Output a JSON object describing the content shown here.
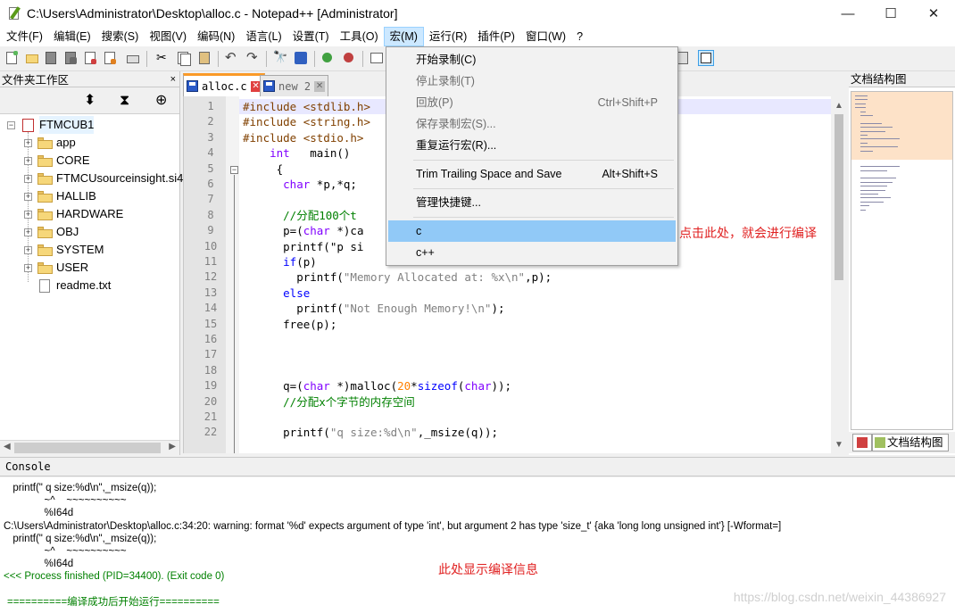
{
  "window": {
    "title": "C:\\Users\\Administrator\\Desktop\\alloc.c - Notepad++ [Administrator]",
    "minimize": "—",
    "maximize": "☐",
    "close": "✕"
  },
  "menubar": {
    "items": [
      "文件(F)",
      "编辑(E)",
      "搜索(S)",
      "视图(V)",
      "编码(N)",
      "语言(L)",
      "设置(T)",
      "工具(O)",
      "宏(M)",
      "运行(R)",
      "插件(P)",
      "窗口(W)",
      "?"
    ]
  },
  "macro_menu": {
    "start_record": "开始录制(C)",
    "stop_record": "停止录制(T)",
    "playback": "回放(P)",
    "playback_shortcut": "Ctrl+Shift+P",
    "save_macro": "保存录制宏(S)...",
    "repeat_run": "重复运行宏(R)...",
    "trim_save": "Trim Trailing Space and Save",
    "trim_save_shortcut": "Alt+Shift+S",
    "manage_shortcuts": "管理快捷键...",
    "macro_c": "c",
    "macro_cpp": "c++"
  },
  "left_panel": {
    "title": "文件夹工作区",
    "close": "×",
    "root": "FTMCUB1",
    "children": [
      "app",
      "CORE",
      "FTMCUsourceinsight.si4",
      "HALLIB",
      "HARDWARE",
      "OBJ",
      "SYSTEM",
      "USER"
    ],
    "file": "readme.txt"
  },
  "tabs": [
    {
      "label": "alloc.c"
    },
    {
      "label": "new 2"
    }
  ],
  "editor": {
    "lines": [
      [
        {
          "c": "pp",
          "t": "#include <stdlib.h>"
        }
      ],
      [
        {
          "c": "pp",
          "t": "#include <string.h>"
        }
      ],
      [
        {
          "c": "pp",
          "t": "#include <stdio.h>"
        }
      ],
      [
        {
          "c": "",
          "t": "    "
        },
        {
          "c": "ty",
          "t": "int"
        },
        {
          "c": "",
          "t": "   main()"
        }
      ],
      [
        {
          "c": "",
          "t": "     {"
        }
      ],
      [
        {
          "c": "",
          "t": "      "
        },
        {
          "c": "ty",
          "t": "char"
        },
        {
          "c": "",
          "t": " *p,*q;"
        }
      ],
      [],
      [
        {
          "c": "",
          "t": "      "
        },
        {
          "c": "cm",
          "t": "//分配100个t"
        }
      ],
      [
        {
          "c": "",
          "t": "      p=("
        },
        {
          "c": "ty",
          "t": "char"
        },
        {
          "c": "",
          "t": " *)ca"
        }
      ],
      [
        {
          "c": "",
          "t": "      printf(\"p si"
        }
      ],
      [
        {
          "c": "",
          "t": "      "
        },
        {
          "c": "kw",
          "t": "if"
        },
        {
          "c": "",
          "t": "(p)"
        }
      ],
      [
        {
          "c": "",
          "t": "        printf("
        },
        {
          "c": "st",
          "t": "\"Memory Allocated at: %x\\n\""
        },
        {
          "c": "",
          "t": ",p);"
        }
      ],
      [
        {
          "c": "",
          "t": "      "
        },
        {
          "c": "kw",
          "t": "else"
        }
      ],
      [
        {
          "c": "",
          "t": "        printf("
        },
        {
          "c": "st",
          "t": "\"Not Enough Memory!\\n\""
        },
        {
          "c": "",
          "t": ");"
        }
      ],
      [
        {
          "c": "",
          "t": "      free(p);"
        }
      ],
      [],
      [],
      [],
      [
        {
          "c": "",
          "t": "      q=("
        },
        {
          "c": "ty",
          "t": "char"
        },
        {
          "c": "",
          "t": " *)malloc("
        },
        {
          "c": "nm",
          "t": "20"
        },
        {
          "c": "",
          "t": "*"
        },
        {
          "c": "kw",
          "t": "sizeof"
        },
        {
          "c": "",
          "t": "("
        },
        {
          "c": "ty",
          "t": "char"
        },
        {
          "c": "",
          "t": "));"
        }
      ],
      [
        {
          "c": "",
          "t": "      "
        },
        {
          "c": "cm",
          "t": "//分配x个字节的内存空间"
        }
      ],
      [],
      [
        {
          "c": "",
          "t": "      printf("
        },
        {
          "c": "st",
          "t": "\"q size:%d\\n\""
        },
        {
          "c": "",
          "t": ",_msize(q));"
        }
      ]
    ]
  },
  "annotations": {
    "menu_hint": "点击此处，就会进行编译",
    "console_hint": "此处显示编译信息"
  },
  "right_panel": {
    "title": "文档结构图",
    "tab_label": "文档结构图"
  },
  "console": {
    "title": "Console",
    "lines": [
      "  printf(\" q size:%d\\n\",_msize(q));",
      "             ~^    ~~~~~~~~~~",
      "             %I64d",
      "C:\\Users\\Administrator\\Desktop\\alloc.c:34:20: warning: format '%d' expects argument of type 'int', but argument 2 has type 'size_t' {aka 'long long unsigned int'} [-Wformat=]",
      "  printf(\" q size:%d\\n\",_msize(q));",
      "             ~^    ~~~~~~~~~~",
      "             %I64d",
      "<<< Process finished (PID=34400). (Exit code 0)",
      "",
      "==========编译成功后开始运行=========="
    ]
  },
  "watermark": "https://blog.csdn.net/weixin_44386927"
}
